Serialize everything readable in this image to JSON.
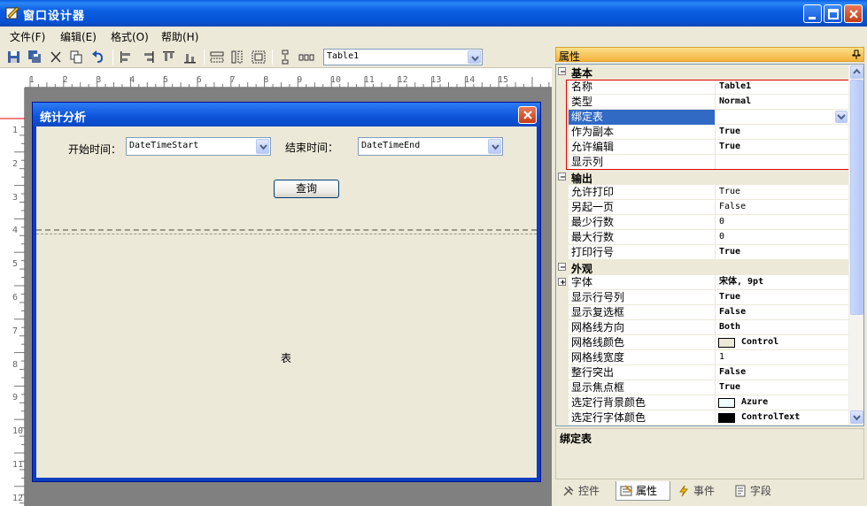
{
  "window": {
    "title": "窗口设计器"
  },
  "menu": [
    "文件(F)",
    "编辑(E)",
    "格式(O)",
    "帮助(H)"
  ],
  "toolbar": {
    "control_select": "Table1"
  },
  "ruler": {
    "h": [
      "1",
      "2",
      "3",
      "4",
      "5",
      "6",
      "7",
      "8",
      "9",
      "10",
      "11",
      "12",
      "13",
      "14",
      "15"
    ],
    "v": [
      "1",
      "2",
      "3",
      "4",
      "5",
      "6",
      "7",
      "8",
      "9",
      "10",
      "11",
      "12"
    ]
  },
  "dialog": {
    "title": "统计分析",
    "start_label": "开始时间：",
    "start_value": "DateTimeStart",
    "end_label": "结束时间：",
    "end_value": "DateTimeEnd",
    "query_button": "查询",
    "table_placeholder": "表"
  },
  "properties": {
    "header": "属性",
    "categories": [
      {
        "name": "基本",
        "rows": [
          {
            "name": "名称",
            "value": "Table1",
            "bold": true
          },
          {
            "name": "类型",
            "value": "Normal",
            "bold": true
          },
          {
            "name": "绑定表",
            "value": "",
            "selected": true,
            "dropdown": true
          },
          {
            "name": "作为副本",
            "value": "True",
            "bold": true
          },
          {
            "name": "允许编辑",
            "value": "True",
            "bold": true
          },
          {
            "name": "显示列",
            "value": ""
          }
        ]
      },
      {
        "name": "输出",
        "rows": [
          {
            "name": "允许打印",
            "value": "True"
          },
          {
            "name": "另起一页",
            "value": "False"
          },
          {
            "name": "最少行数",
            "value": "0"
          },
          {
            "name": "最大行数",
            "value": "0"
          },
          {
            "name": "打印行号",
            "value": "True",
            "bold": true
          }
        ]
      },
      {
        "name": "外观",
        "rows": [
          {
            "name": "字体",
            "value": "宋体, 9pt",
            "bold": true,
            "expandable": true
          },
          {
            "name": "显示行号列",
            "value": "True",
            "bold": true
          },
          {
            "name": "显示复选框",
            "value": "False",
            "bold": true
          },
          {
            "name": "网格线方向",
            "value": "Both",
            "bold": true
          },
          {
            "name": "网格线颜色",
            "value": "Control",
            "bold": true,
            "swatch": "#ece9d8"
          },
          {
            "name": "网格线宽度",
            "value": "1"
          },
          {
            "name": "整行突出",
            "value": "False",
            "bold": true
          },
          {
            "name": "显示焦点框",
            "value": "True",
            "bold": true
          },
          {
            "name": "选定行背景颜色",
            "value": "Azure",
            "bold": true,
            "swatch": "#f0ffff"
          },
          {
            "name": "选定行字体颜色",
            "value": "ControlText",
            "bold": true,
            "swatch": "#000000"
          }
        ]
      }
    ],
    "description_title": "绑定表"
  },
  "tabs": [
    {
      "label": "控件",
      "icon": "tools-icon"
    },
    {
      "label": "属性",
      "icon": "properties-icon",
      "active": true
    },
    {
      "label": "事件",
      "icon": "lightning-icon"
    },
    {
      "label": "字段",
      "icon": "fields-icon"
    }
  ]
}
